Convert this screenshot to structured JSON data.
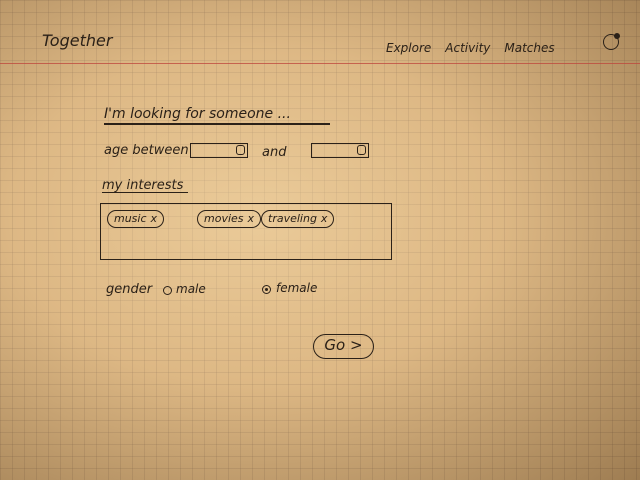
{
  "header": {
    "logo": "Together",
    "nav": [
      "Explore",
      "Activity",
      "Matches"
    ],
    "close_icon": "close-circle-icon"
  },
  "search": {
    "headline": "I'm looking for someone ...",
    "age_between_label": "age between",
    "and_label": "and",
    "interests_label": "my interests",
    "interests": [
      {
        "label": "music",
        "remove": "x"
      },
      {
        "label": "movies",
        "remove": "x"
      },
      {
        "label": "traveling",
        "remove": "x"
      }
    ],
    "gender_label": "gender",
    "gender_options": [
      {
        "label": "male",
        "selected": false
      },
      {
        "label": "female",
        "selected": true
      }
    ],
    "go_label": "Go >"
  },
  "colors": {
    "ink": "#2b2118",
    "paper": "#d2ac78",
    "margin_line": "#be463c"
  }
}
